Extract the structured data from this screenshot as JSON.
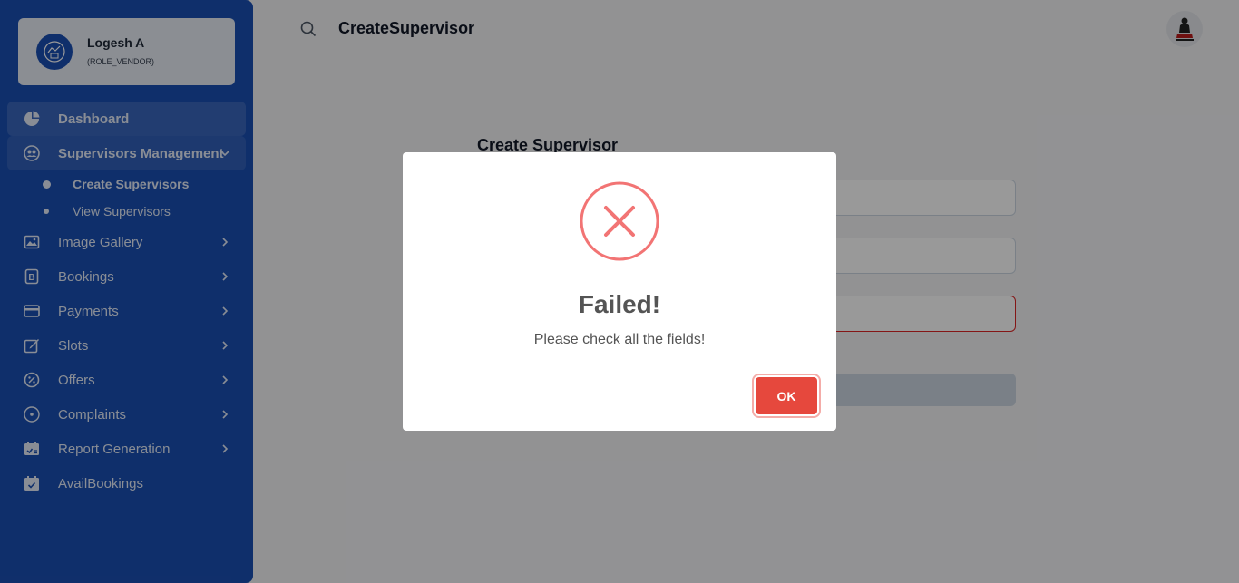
{
  "user": {
    "name": "Logesh A",
    "role": "(ROLE_VENDOR)"
  },
  "sidebar": {
    "items": [
      {
        "label": "Dashboard",
        "icon": "pie-chart-icon",
        "has_chevron": false
      },
      {
        "label": "Supervisors Management",
        "icon": "users-icon",
        "has_chevron": true,
        "expanded": true
      },
      {
        "label": "Image Gallery",
        "icon": "image-icon",
        "has_chevron": true
      },
      {
        "label": "Bookings",
        "icon": "bookings-icon",
        "has_chevron": true
      },
      {
        "label": "Payments",
        "icon": "credit-card-icon",
        "has_chevron": true
      },
      {
        "label": "Slots",
        "icon": "edit-icon",
        "has_chevron": true
      },
      {
        "label": "Offers",
        "icon": "discount-icon",
        "has_chevron": true
      },
      {
        "label": "Complaints",
        "icon": "circle-dot-icon",
        "has_chevron": true
      },
      {
        "label": "Report Generation",
        "icon": "report-icon",
        "has_chevron": true
      },
      {
        "label": "AvailBookings",
        "icon": "calendar-check-icon",
        "has_chevron": false
      }
    ],
    "subitems": [
      {
        "label": "Create Supervisors",
        "current": true
      },
      {
        "label": "View Supervisors",
        "current": false
      }
    ]
  },
  "header": {
    "title": "CreateSupervisor"
  },
  "form": {
    "title": "Create Supervisor"
  },
  "modal": {
    "title": "Failed!",
    "message": "Please check all the fields!",
    "ok_label": "OK",
    "icon": "error-x-icon"
  },
  "colors": {
    "sidebar_bg": "#1a4fb3",
    "error_red": "#e6483d",
    "icon_red": "#f27474"
  }
}
